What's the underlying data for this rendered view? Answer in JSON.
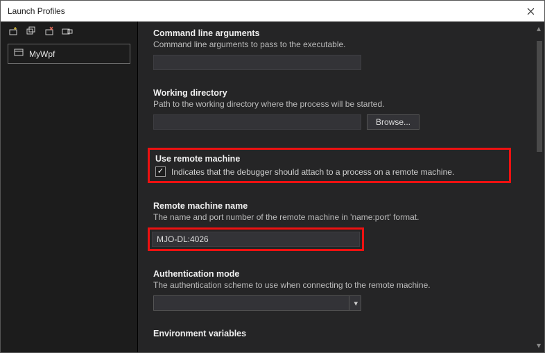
{
  "window": {
    "title": "Launch Profiles"
  },
  "sidebar": {
    "profiles": [
      {
        "label": "MyWpf"
      }
    ]
  },
  "sections": {
    "cli_args": {
      "title": "Command line arguments",
      "desc": "Command line arguments to pass to the executable.",
      "value": ""
    },
    "workdir": {
      "title": "Working directory",
      "desc": "Path to the working directory where the process will be started.",
      "value": "",
      "browse": "Browse..."
    },
    "remote": {
      "title": "Use remote machine",
      "checkbox_label": "Indicates that the debugger should attach to a process on a remote machine.",
      "checked": true
    },
    "remote_name": {
      "title": "Remote machine name",
      "desc": "The name and port number of the remote machine in 'name:port' format.",
      "value": "MJO-DL:4026"
    },
    "auth": {
      "title": "Authentication mode",
      "desc": "The authentication scheme to use when connecting to the remote machine.",
      "value": ""
    },
    "env": {
      "title": "Environment variables"
    }
  }
}
